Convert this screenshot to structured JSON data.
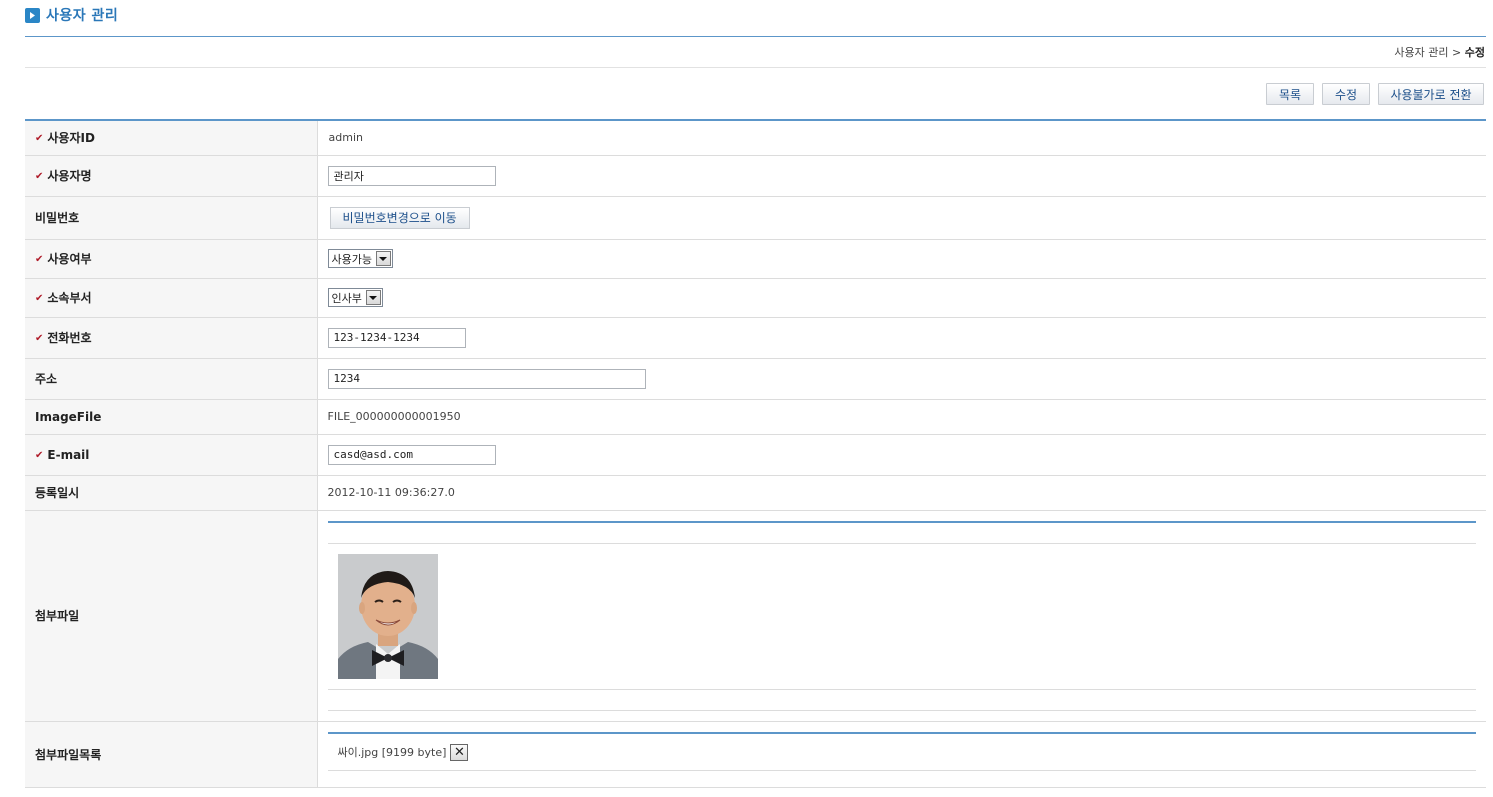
{
  "header": {
    "title": "사용자 관리",
    "breadcrumb_parent": "사용자 관리",
    "breadcrumb_sep": ">",
    "breadcrumb_current": "수정"
  },
  "toolbar": {
    "list_label": "목록",
    "edit_label": "수정",
    "disable_label": "사용불가로 전환"
  },
  "form": {
    "user_id": {
      "label": "사용자ID",
      "value": "admin"
    },
    "user_name": {
      "label": "사용자명",
      "value": "관리자"
    },
    "password": {
      "label": "비밀번호",
      "button": "비밀번호변경으로 이동"
    },
    "usage": {
      "label": "사용여부",
      "selected": "사용가능"
    },
    "department": {
      "label": "소속부서",
      "selected": "인사부"
    },
    "phone": {
      "label": "전화번호",
      "value": "123-1234-1234"
    },
    "address": {
      "label": "주소",
      "value": "1234"
    },
    "image_file": {
      "label": "ImageFile",
      "value": "FILE_000000000001950"
    },
    "email": {
      "label": "E-mail",
      "value": "casd@asd.com"
    },
    "reg_date": {
      "label": "등록일시",
      "value": "2012-10-11 09:36:27.0"
    },
    "attachment": {
      "label": "첨부파일"
    },
    "attachment_list": {
      "label": "첨부파일목록",
      "file_text": "싸이.jpg [9199 byte]",
      "delete_icon": "close-x"
    }
  },
  "colors": {
    "accent_blue": "#2a86c6",
    "required_mark": "#b01c2a",
    "label_bg": "#f6f6f6"
  }
}
